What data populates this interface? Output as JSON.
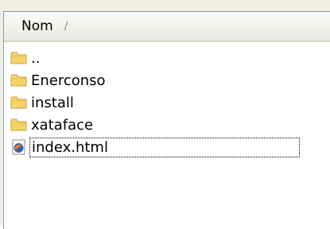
{
  "header": {
    "column_name": "Nom",
    "sort_indicator": "/"
  },
  "files": [
    {
      "name": "..",
      "type": "folder"
    },
    {
      "name": "Enerconso",
      "type": "folder"
    },
    {
      "name": "install",
      "type": "folder"
    },
    {
      "name": "xataface",
      "type": "folder"
    },
    {
      "name": "index.html",
      "type": "html",
      "focused": true
    }
  ],
  "icons": {
    "folder": "folder-icon",
    "html": "firefox-html-icon"
  },
  "colors": {
    "folder_fill": "#f5d36a",
    "folder_dark": "#c9a03a",
    "header_border": "#d6d2c2"
  }
}
